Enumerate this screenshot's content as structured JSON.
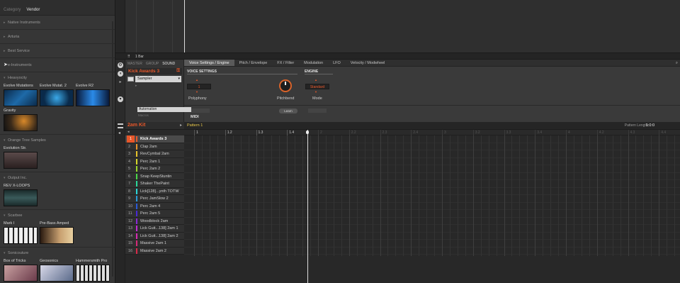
{
  "browser": {
    "tabs": [
      "Category",
      "Vendor"
    ],
    "active_tab": "Vendor",
    "collapsed_top": [
      "Native Instruments",
      "Arturia",
      "Best Service",
      "e-Instruments"
    ],
    "groups": [
      {
        "name": "Heavyocity",
        "items": [
          "Evolve Mutations",
          "Evolve Mutat. 2",
          "Evolve R2",
          "Gravity"
        ]
      },
      {
        "name": "Orange Tree Samples",
        "items": [
          "Evolution Str."
        ]
      },
      {
        "name": "Output Inc.",
        "items": [
          "REV X-LOOPS"
        ]
      },
      {
        "name": "Scarbee",
        "items": [
          "Mark I",
          "Pre-Bass Amped"
        ]
      },
      {
        "name": "Sonicouture",
        "items": [
          "Box of Tricks",
          "Geosonics",
          "Hammersmith Pro"
        ]
      }
    ]
  },
  "arranger": {
    "bar_label": "1 Bar"
  },
  "control": {
    "modes": [
      "MASTER",
      "GROUP",
      "SOUND"
    ],
    "active_mode": "SOUND",
    "sound_name": "Kick Awards 3",
    "plugin": "Sampler",
    "automation_label": "Automation",
    "macro_label": "Macros",
    "tabs": [
      "Voice Settings / Engine",
      "Pitch / Envelope",
      "FX / Filter",
      "Modulation",
      "LFO",
      "Velocity / Modwheel"
    ],
    "active_tab": "Voice Settings / Engine",
    "sections": {
      "voice": "VOICE SETTINGS",
      "engine": "ENGINE"
    },
    "polyphony": {
      "label": "Polyphony",
      "value": "1"
    },
    "pitchbend": {
      "label": "Pitchbend"
    },
    "mode": {
      "label": "Mode",
      "value": "Standard"
    },
    "learn_label": "Learn",
    "midi_label": "MIDI"
  },
  "pattern": {
    "kit_name": "2am Kit",
    "pattern_name": "Pattern 1",
    "length_label": "Pattern Length:",
    "length_value": "1:0:0",
    "ruler": [
      "1",
      "1.2",
      "1.3",
      "1.4",
      "2",
      "2.2",
      "2.3",
      "2.4",
      "3",
      "3.2",
      "3.3",
      "3.4",
      "4",
      "4.2",
      "4.3",
      "4.4"
    ],
    "selected_slot": 1,
    "slots": [
      {
        "n": "1",
        "name": "Kick Awards 3",
        "color": "#e8572a"
      },
      {
        "n": "2",
        "name": "Clap 2am",
        "color": "#e8952a"
      },
      {
        "n": "3",
        "name": "RevCymbal 2am",
        "color": "#e8c42a"
      },
      {
        "n": "4",
        "name": "Perc 2am 1",
        "color": "#d8d82a"
      },
      {
        "n": "5",
        "name": "Perc 2am 2",
        "color": "#9ad82a"
      },
      {
        "n": "6",
        "name": "Snap KeepStuntin",
        "color": "#4ad84a"
      },
      {
        "n": "7",
        "name": "Shaker ThePaint",
        "color": "#2ad89a"
      },
      {
        "n": "8",
        "name": "Lick[128]...ynth TOTW",
        "color": "#2ad8d8"
      },
      {
        "n": "9",
        "name": "Perc JamSlow 2",
        "color": "#2a9ad8"
      },
      {
        "n": "10",
        "name": "Perc 2am 4",
        "color": "#2a5ad8"
      },
      {
        "n": "11",
        "name": "Perc 2am 5",
        "color": "#4a2ad8"
      },
      {
        "n": "12",
        "name": "Woodblock 2am",
        "color": "#8a2ad8"
      },
      {
        "n": "13",
        "name": "Lick Guit...138] 2am 1",
        "color": "#c42ad8"
      },
      {
        "n": "14",
        "name": "Lick Guit...138] 2am 2",
        "color": "#d82ab4"
      },
      {
        "n": "15",
        "name": "Massive 2am 1",
        "color": "#d82a7a"
      },
      {
        "n": "16",
        "name": "Massive 2am 2",
        "color": "#d82a4a"
      }
    ]
  }
}
